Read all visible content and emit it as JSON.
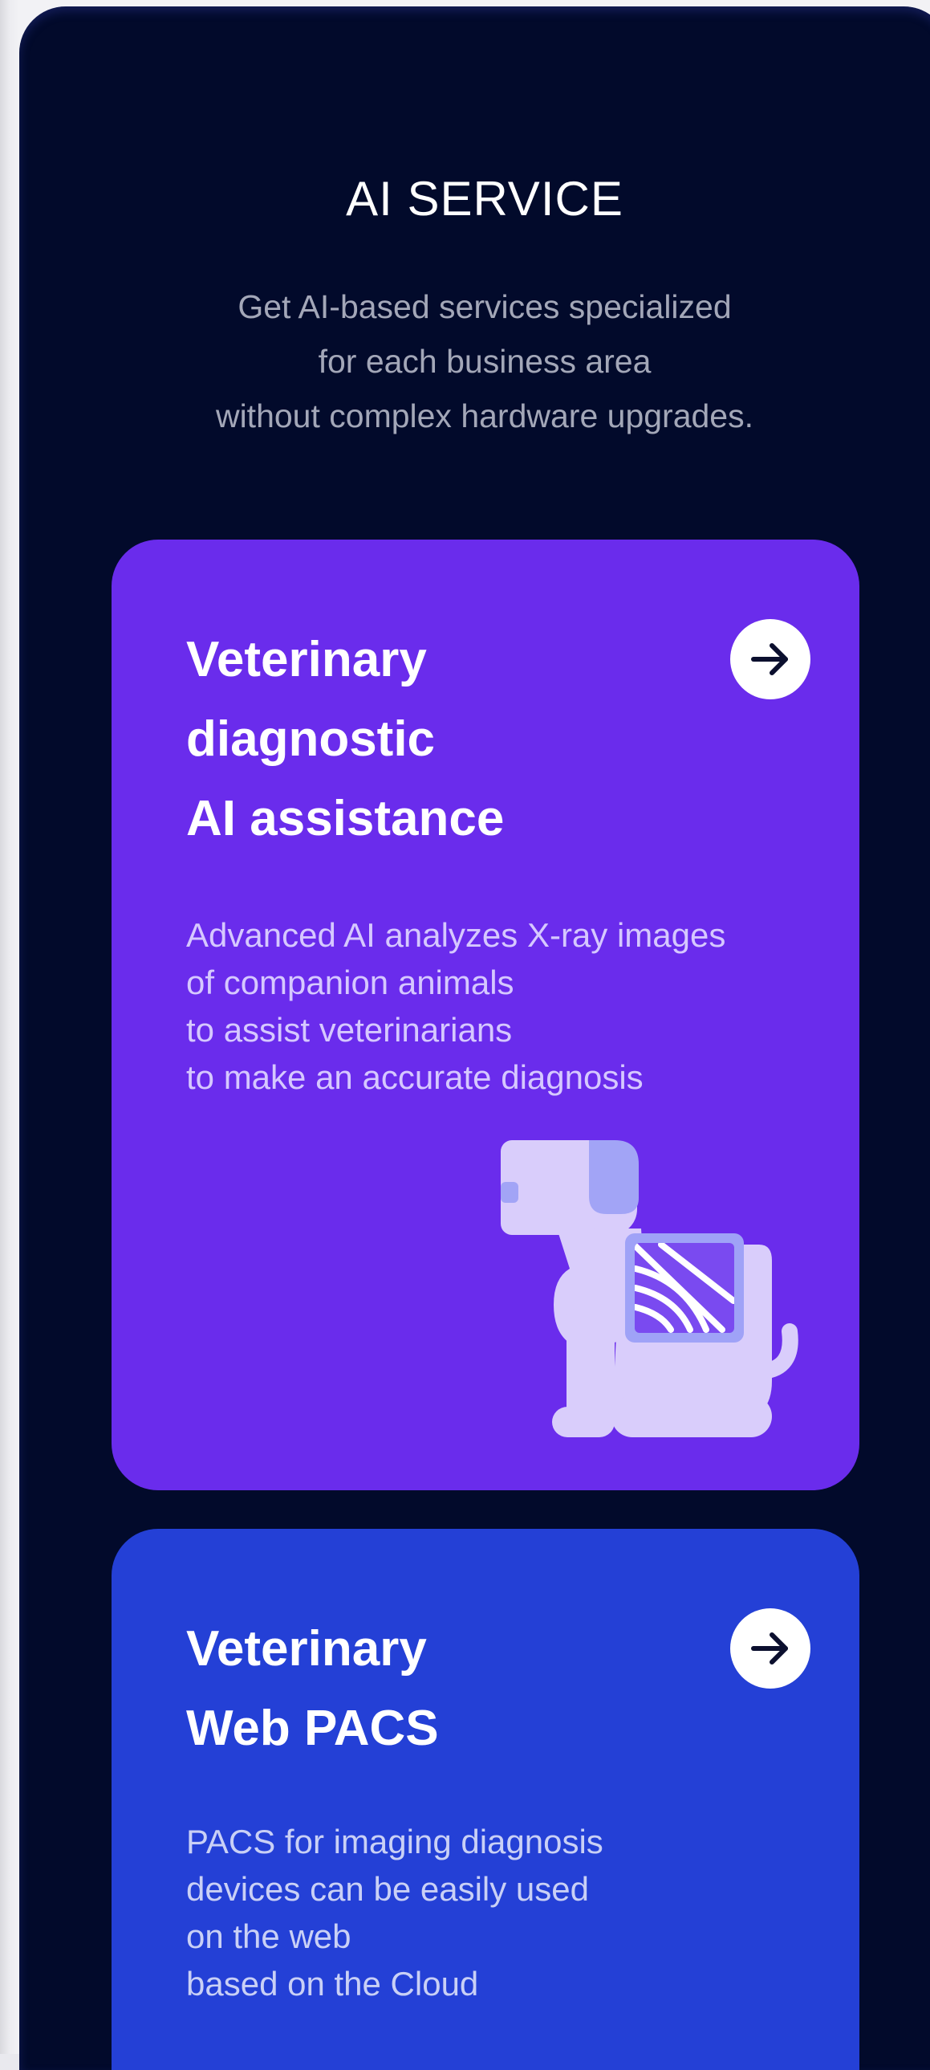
{
  "section": {
    "title": "AI SERVICE",
    "subtitle_lines": [
      "Get AI-based services specialized",
      "for each business area",
      "without complex hardware upgrades."
    ]
  },
  "cards": [
    {
      "title_lines": [
        "Veterinary",
        "diagnostic",
        "AI assistance"
      ],
      "description_lines": [
        "Advanced AI analyzes X-ray images",
        "of companion animals",
        "to assist veterinarians",
        "to make an accurate diagnosis"
      ],
      "icon": "arrow-right-icon",
      "illustration": "dog-xray-illustration",
      "background": "#6a2cec"
    },
    {
      "title_lines": [
        "Veterinary",
        "Web PACS"
      ],
      "description_lines": [
        "PACS for imaging diagnosis",
        "devices can be easily used",
        "on the web",
        "based on the Cloud"
      ],
      "icon": "arrow-right-icon",
      "background": "#2440d6"
    }
  ],
  "colors": {
    "section_background": "#020a2b",
    "card_purple": "#6a2cec",
    "card_blue": "#2440d6",
    "illustration_light": "#d9cdfb",
    "illustration_accent": "#9fa2f7"
  }
}
